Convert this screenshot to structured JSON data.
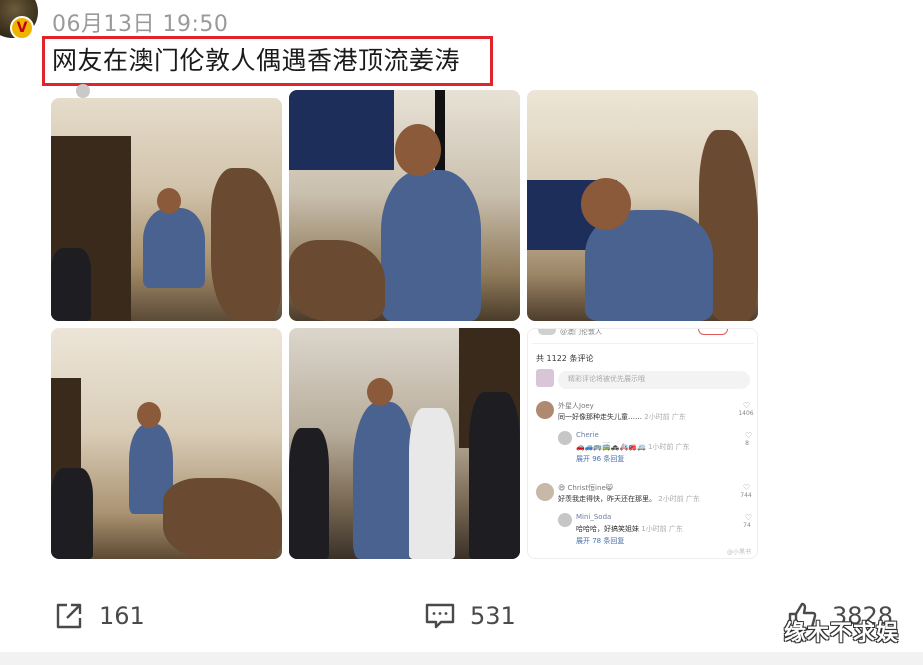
{
  "post": {
    "timestamp": "06月13日 19:50",
    "title": "网友在澳门伦敦人偶遇香港顶流姜涛"
  },
  "avatar": {
    "badge": "V"
  },
  "photos": [
    {
      "name": "photo-1"
    },
    {
      "name": "photo-2"
    },
    {
      "name": "photo-3"
    },
    {
      "name": "photo-4"
    },
    {
      "name": "photo-5"
    }
  ],
  "comment_screenshot": {
    "header": "@澳门伦敦人",
    "count": "共 1122 条评论",
    "input_placeholder": "精彩评论将被优先展示哦",
    "comments": [
      {
        "name": "外星人Joey",
        "text": "同一好像那种走失儿童……",
        "meta": "2小时前 广东",
        "likes": "1406",
        "reply": {
          "name": "Cherie",
          "text": "🚗🚙🚌🚎🚓🚑🚒🚐",
          "meta": "1小时前 广东",
          "likes": "8",
          "expand": "展开 96 条回复"
        }
      },
      {
        "name": "😄 Christ恒ine😸",
        "text": "好羡我走得快，昨天还在那里。",
        "meta": "2小时前 广东",
        "likes": "744",
        "reply": {
          "name": "Mini_Soda",
          "text": "哈哈哈，好搞笑姐妹",
          "meta": "1小时前 广东",
          "likes": "74",
          "expand": "展开 78 条回复"
        }
      }
    ],
    "watermark": "@小黑书"
  },
  "actions": {
    "share_count": "161",
    "comment_count": "531",
    "like_count": "3828"
  },
  "watermark": "缘木不求娱",
  "colors": {
    "title_box_border": "#e0242a",
    "timestamp": "#9a9a9a",
    "action_text": "#4a4a4a"
  },
  "icons": {
    "share": "share-icon",
    "comment": "comment-icon",
    "like": "thumbs-up-icon"
  }
}
